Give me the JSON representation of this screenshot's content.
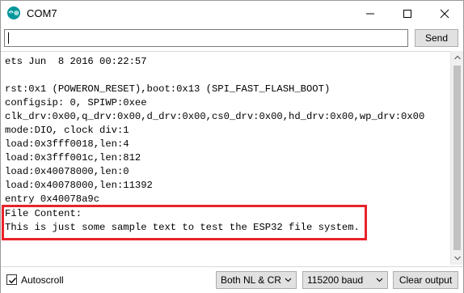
{
  "window": {
    "title": "COM7",
    "app_icon": "arduino-icon",
    "controls": {
      "minimize": "minimize-icon",
      "maximize": "maximize-icon",
      "close": "close-icon"
    }
  },
  "input": {
    "value": "",
    "send_label": "Send"
  },
  "output": {
    "lines": [
      "ets Jun  8 2016 00:22:57",
      "",
      "rst:0x1 (POWERON_RESET),boot:0x13 (SPI_FAST_FLASH_BOOT)",
      "configsip: 0, SPIWP:0xee",
      "clk_drv:0x00,q_drv:0x00,d_drv:0x00,cs0_drv:0x00,hd_drv:0x00,wp_drv:0x00",
      "mode:DIO, clock div:1",
      "load:0x3fff0018,len:4",
      "load:0x3fff001c,len:812",
      "load:0x40078000,len:0",
      "load:0x40078000,len:11392",
      "entry 0x40078a9c",
      "File Content:",
      "This is just some sample text to test the ESP32 file system."
    ],
    "highlight_color": "#e8232a"
  },
  "bottom": {
    "autoscroll_label": "Autoscroll",
    "autoscroll_checked": true,
    "line_ending": "Both NL & CR",
    "baud_rate": "115200 baud",
    "clear_label": "Clear output"
  },
  "colors": {
    "arduino_teal": "#00979c",
    "button_bg": "#e1e1e1"
  }
}
